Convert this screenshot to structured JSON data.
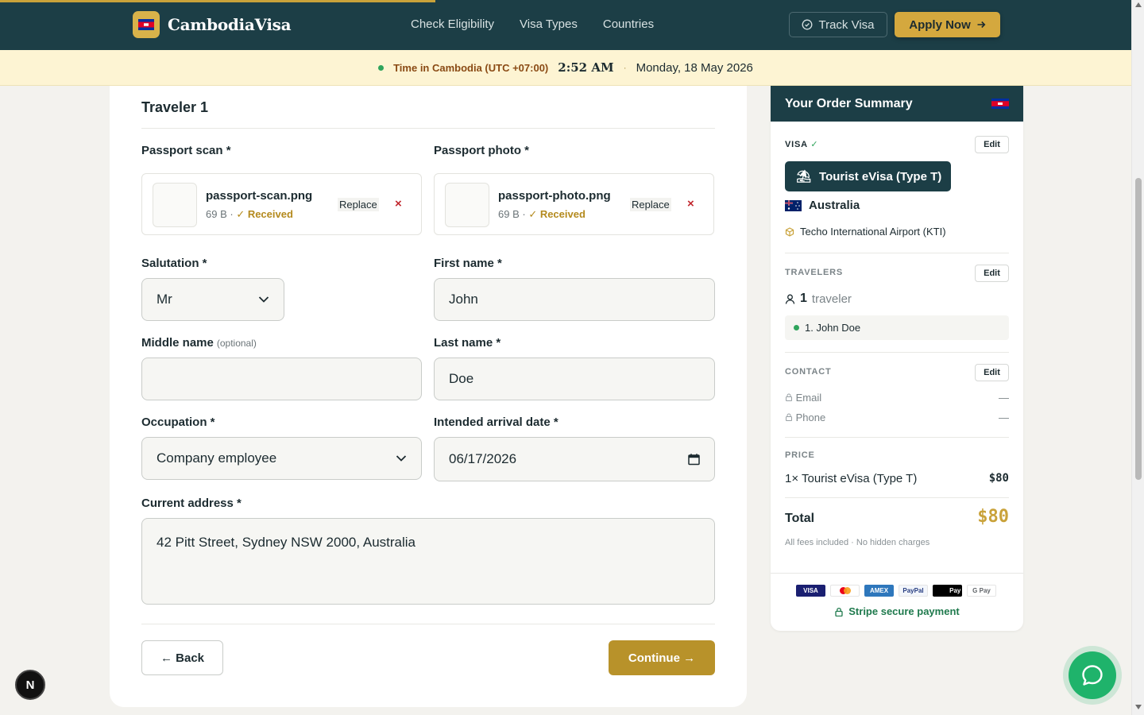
{
  "header": {
    "brand": "CambodiaVisa",
    "nav": [
      "Check Eligibility",
      "Visa Types",
      "Countries"
    ],
    "track_label": "Track Visa",
    "apply_label": "Apply Now"
  },
  "timebar": {
    "label": "Time in Cambodia (UTC +07:00)",
    "time": "2:52 AM",
    "separator": "·",
    "date": "Monday, 18 May 2026"
  },
  "form": {
    "traveler_title": "Traveler 1",
    "passport_scan": {
      "label": "Passport scan *",
      "filename": "passport-scan.png",
      "size": "69 B ·",
      "status": "✓ Received",
      "replace_label": "Replace",
      "remove_label": "×"
    },
    "passport_photo": {
      "label": "Passport photo *",
      "filename": "passport-photo.png",
      "size": "69 B ·",
      "status": "✓ Received",
      "replace_label": "Replace",
      "remove_label": "×"
    },
    "salutation": {
      "label": "Salutation *",
      "value": "Mr"
    },
    "first_name": {
      "label": "First name *",
      "value": "John"
    },
    "middle_name": {
      "label": "Middle name",
      "optional": "(optional)",
      "value": ""
    },
    "last_name": {
      "label": "Last name *",
      "value": "Doe"
    },
    "occupation": {
      "label": "Occupation *",
      "value": "Company employee"
    },
    "arrival_date": {
      "label": "Intended arrival date *",
      "value": "06/17/2026"
    },
    "address": {
      "label": "Current address *",
      "value": "42 Pitt Street, Sydney NSW 2000, Australia"
    },
    "back_label": "← Back",
    "continue_label": "Continue →"
  },
  "summary": {
    "title": "Your Order Summary",
    "visa_label": "VISA",
    "visa_check": "✓",
    "edit_label": "Edit",
    "visa_type": "Tourist eVisa (Type T)",
    "country": "Australia",
    "airport": "Techo International Airport (KTI)",
    "travelers_label": "TRAVELERS",
    "traveler_count": "1",
    "traveler_word": "traveler",
    "traveler_entry": "1. John Doe",
    "contact_label": "CONTACT",
    "email_label": "Email",
    "email_value": "—",
    "phone_label": "Phone",
    "phone_value": "—",
    "price_label": "PRICE",
    "line_item": "1× Tourist eVisa (Type T)",
    "line_amount": "$80",
    "total_label": "Total",
    "total_amount": "$80",
    "fees_note": "All fees included · No hidden charges",
    "payment_methods": [
      "VISA",
      "AMEX",
      "PayPal",
      "Pay",
      "G Pay"
    ],
    "secure_label": "Stripe secure payment"
  },
  "dev_badge": "N",
  "colors": {
    "navy": "#1c3e46",
    "gold": "#d4a83e",
    "continue_gold": "#b8922a",
    "success_green": "#2fa45c",
    "remove_red": "#c1272d"
  }
}
